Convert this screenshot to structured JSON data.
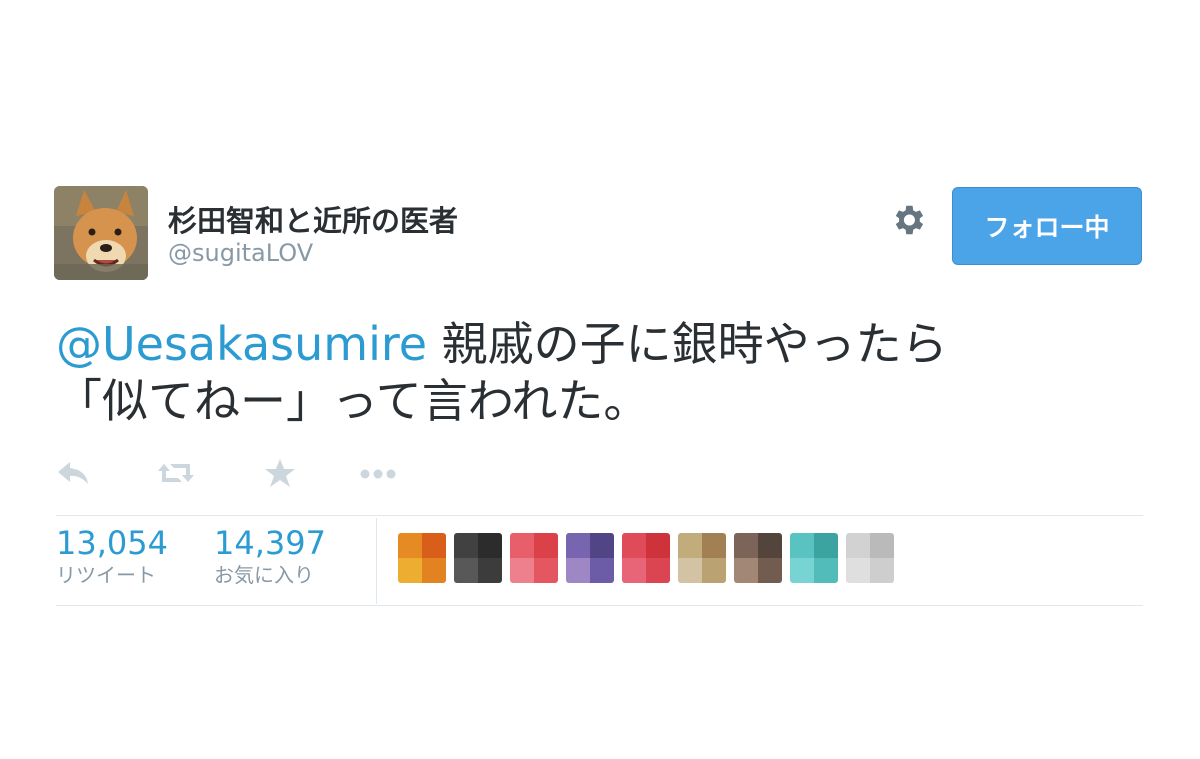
{
  "user": {
    "display_name": "杉田智和と近所の医者",
    "screen_name": "@sugitaLOV"
  },
  "follow_button": {
    "label": "フォロー中"
  },
  "tweet": {
    "mention": "@Uesakasumire",
    "text_line1": " 親戚の子に銀時やったら",
    "text_line2": "「似てねー」って言われた。"
  },
  "actions": {
    "icons": [
      "reply-icon",
      "retweet-icon",
      "favorite-icon",
      "more-icon"
    ]
  },
  "stats": {
    "retweets": {
      "count": "13,054",
      "label": "リツイート"
    },
    "favorites": {
      "count": "14,397",
      "label": "お気に入り"
    }
  },
  "favoriters": {
    "colors": [
      "#e07a20",
      "#3a3a3a",
      "#e2555e",
      "#6a5aa0",
      "#d8434f",
      "#b59a6e",
      "#6e5a4e",
      "#4fb6b4",
      "#c9c9c9"
    ]
  },
  "colors": {
    "accent": "#2b9bd2",
    "follow_button": "#4ba3e8",
    "muted": "#8899a6"
  }
}
